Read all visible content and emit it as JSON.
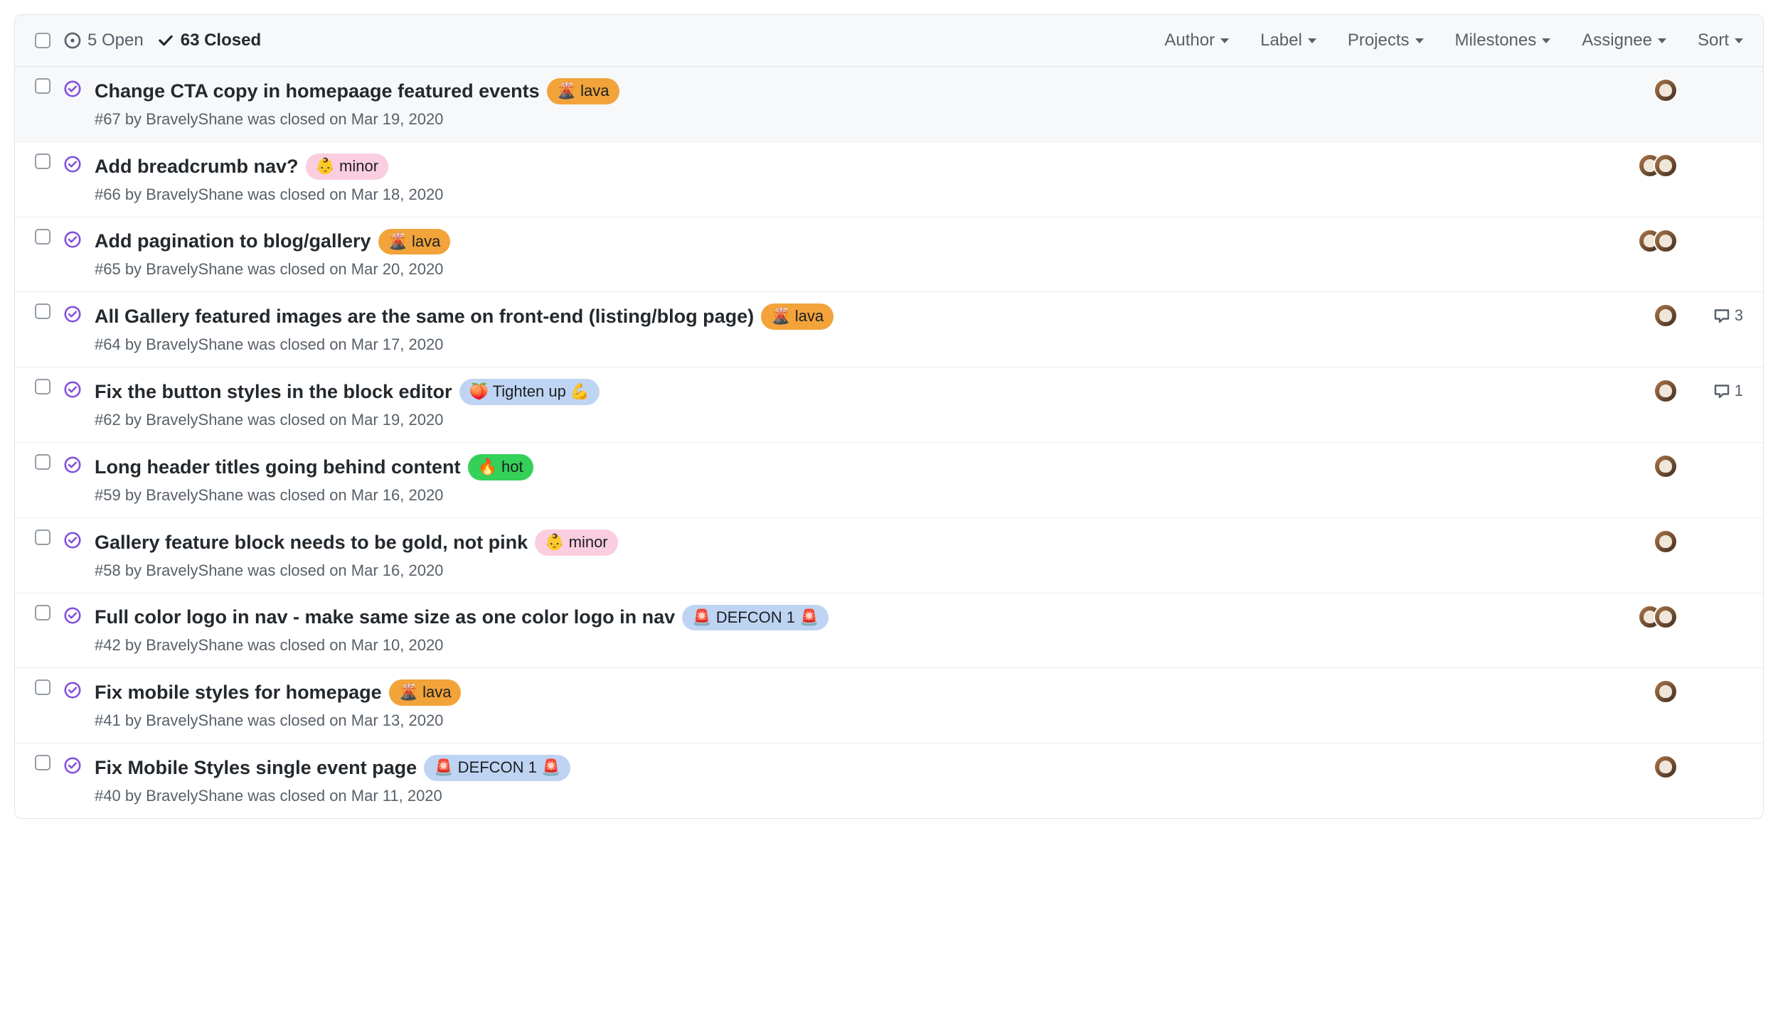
{
  "header": {
    "open_count": 5,
    "open_label": "Open",
    "closed_count": 63,
    "closed_label": "Closed",
    "filters": [
      "Author",
      "Label",
      "Projects",
      "Milestones",
      "Assignee",
      "Sort"
    ]
  },
  "labels": {
    "lava": {
      "text": "lava",
      "emoji": "🌋",
      "bg": "#f2a33a",
      "fg": "#1b1f23"
    },
    "minor": {
      "text": "minor",
      "emoji": "👶",
      "bg": "#fbcde0",
      "fg": "#1b1f23"
    },
    "tighten": {
      "text": "Tighten up",
      "emoji": "🍑",
      "emoji2": "💪",
      "bg": "#bfd4f2",
      "fg": "#1b1f23"
    },
    "hot": {
      "text": "hot",
      "emoji": "🔥",
      "bg": "#34d058",
      "fg": "#1b1f23"
    },
    "defcon1": {
      "text": "DEFCON 1",
      "emoji": "🚨",
      "emoji2": "🚨",
      "bg": "#bfd4f2",
      "fg": "#1b1f23"
    }
  },
  "issues": [
    {
      "title": "Change CTA copy in homepaage featured events",
      "label_key": "lava",
      "number": 67,
      "author": "BravelyShane",
      "closed_on": "Mar 19, 2020",
      "assignees": 1,
      "comments": null
    },
    {
      "title": "Add breadcrumb nav?",
      "label_key": "minor",
      "number": 66,
      "author": "BravelyShane",
      "closed_on": "Mar 18, 2020",
      "assignees": 2,
      "comments": null
    },
    {
      "title": "Add pagination to blog/gallery",
      "label_key": "lava",
      "number": 65,
      "author": "BravelyShane",
      "closed_on": "Mar 20, 2020",
      "assignees": 2,
      "comments": null
    },
    {
      "title": "All Gallery featured images are the same on front-end (listing/blog page)",
      "label_key": "lava",
      "number": 64,
      "author": "BravelyShane",
      "closed_on": "Mar 17, 2020",
      "assignees": 1,
      "comments": 3
    },
    {
      "title": "Fix the button styles in the block editor",
      "label_key": "tighten",
      "number": 62,
      "author": "BravelyShane",
      "closed_on": "Mar 19, 2020",
      "assignees": 1,
      "comments": 1
    },
    {
      "title": "Long header titles going behind content",
      "label_key": "hot",
      "number": 59,
      "author": "BravelyShane",
      "closed_on": "Mar 16, 2020",
      "assignees": 1,
      "comments": null
    },
    {
      "title": "Gallery feature block needs to be gold, not pink",
      "label_key": "minor",
      "number": 58,
      "author": "BravelyShane",
      "closed_on": "Mar 16, 2020",
      "assignees": 1,
      "comments": null
    },
    {
      "title": "Full color logo in nav - make same size as one color logo in nav",
      "label_key": "defcon1",
      "number": 42,
      "author": "BravelyShane",
      "closed_on": "Mar 10, 2020",
      "assignees": 2,
      "comments": null
    },
    {
      "title": "Fix mobile styles for homepage",
      "label_key": "lava",
      "number": 41,
      "author": "BravelyShane",
      "closed_on": "Mar 13, 2020",
      "assignees": 1,
      "comments": null
    },
    {
      "title": "Fix Mobile Styles single event page",
      "label_key": "defcon1",
      "number": 40,
      "author": "BravelyShane",
      "closed_on": "Mar 11, 2020",
      "assignees": 1,
      "comments": null
    }
  ]
}
